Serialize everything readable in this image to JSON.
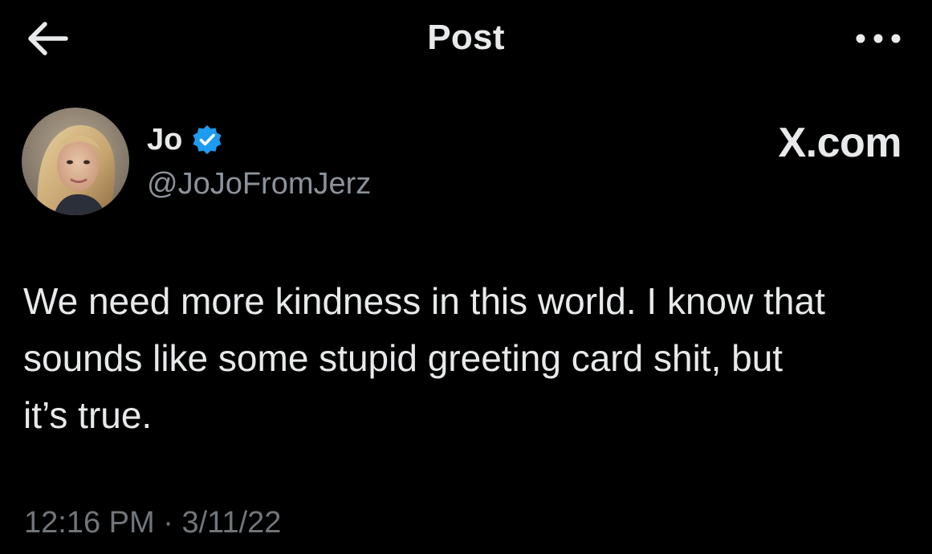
{
  "header": {
    "title": "Post",
    "back_icon": "arrow-left-icon",
    "more_icon": "more-dots-icon"
  },
  "author": {
    "name": "Jo",
    "handle": "@JoJoFromJerz",
    "verified": true,
    "verified_color": "#1d9bf0",
    "avatar_icon": "profile-photo"
  },
  "brand": {
    "logo_text": "X.com"
  },
  "post": {
    "text": "We need more kindness in this world. I know that\nsounds like some stupid greeting card shit, but\nit’s true."
  },
  "meta": {
    "time": "12:16 PM",
    "separator": " · ",
    "date": "3/11/22"
  },
  "colors": {
    "background": "#000000",
    "primary_text": "#e7e9ea",
    "secondary_text": "#71767b",
    "accent": "#1d9bf0"
  }
}
